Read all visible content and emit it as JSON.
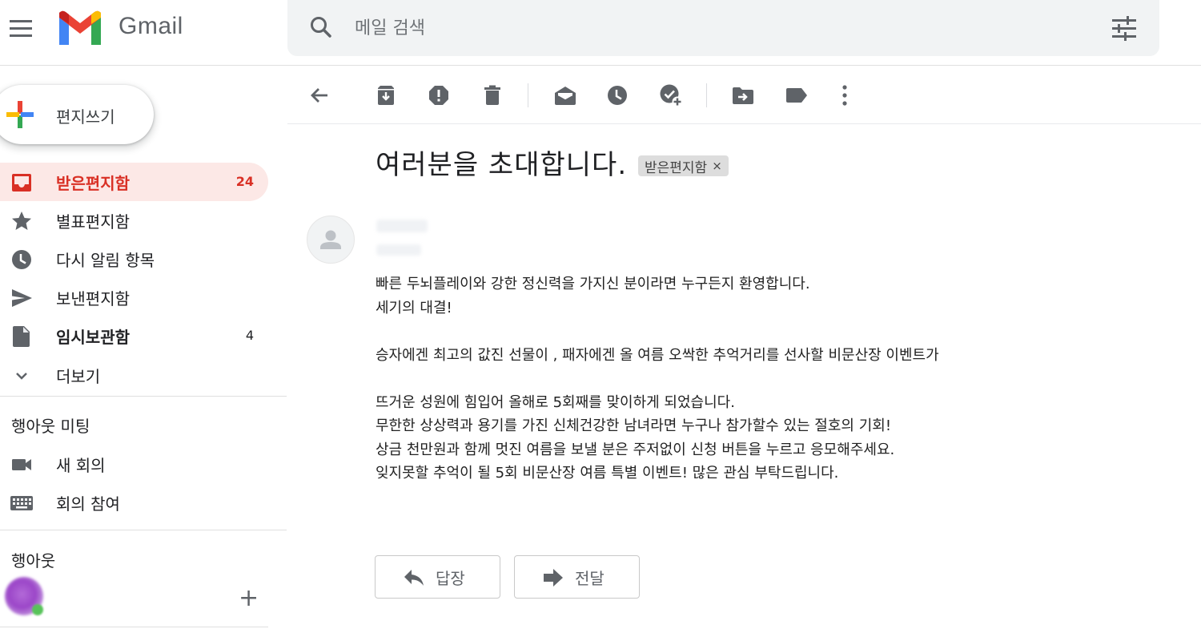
{
  "app": {
    "name": "Gmail"
  },
  "search": {
    "placeholder": "메일 검색"
  },
  "compose": {
    "label": "편지쓰기"
  },
  "nav": [
    {
      "label": "받은편지함",
      "count": "24",
      "icon": "inbox-icon",
      "active": true
    },
    {
      "label": "별표편지함",
      "count": "",
      "icon": "star-icon"
    },
    {
      "label": "다시 알림 항목",
      "count": "",
      "icon": "clock-icon"
    },
    {
      "label": "보낸편지함",
      "count": "",
      "icon": "send-icon"
    },
    {
      "label": "임시보관함",
      "count": "4",
      "icon": "draft-icon",
      "bold": true
    },
    {
      "label": "더보기",
      "count": "",
      "icon": "chevron-down-icon"
    }
  ],
  "meet": {
    "title": "행아웃 미팅",
    "items": [
      {
        "label": "새 회의",
        "icon": "video-icon"
      },
      {
        "label": "회의 참여",
        "icon": "keyboard-icon"
      }
    ]
  },
  "hangouts": {
    "title": "행아웃",
    "add_symbol": "+"
  },
  "toolbar": {
    "icons": [
      "back-arrow-icon",
      "archive-icon",
      "report-spam-icon",
      "delete-icon",
      "mark-unread-icon",
      "snooze-icon",
      "add-to-tasks-icon",
      "move-to-icon",
      "label-icon",
      "more-vert-icon"
    ]
  },
  "message": {
    "subject": "여러분을 초대합니다.",
    "label_chip": "받은편지함",
    "label_chip_close": "×",
    "body": [
      "빠른 두뇌플레이와 강한 정신력을 가지신 분이라면 누구든지 환영합니다.",
      "세기의 대결!",
      "",
      "승자에겐 최고의 값진 선물이 , 패자에겐 올 여름 오싹한 추억거리를 선사할 비문산장 이벤트가",
      "",
      "뜨거운 성원에 힘입어 올해로 5회째를 맞이하게 되었습니다.",
      "무한한 상상력과 용기를 가진 신체건강한 남녀라면 누구나 참가할수 있는 절호의 기회!",
      "상금 천만원과 함께 멋진 여름을 보낼 분은 주저없이 신청 버튼을 누르고 응모해주세요.",
      "잊지못할 추억이 될 5회 비문산장 여름 특별 이벤트! 많은 관심 부탁드립니다."
    ]
  },
  "actions": {
    "reply": "답장",
    "forward": "전달"
  },
  "colors": {
    "accent_red": "#d93025",
    "active_bg": "#fce8e6",
    "search_bg": "#f1f3f4"
  }
}
